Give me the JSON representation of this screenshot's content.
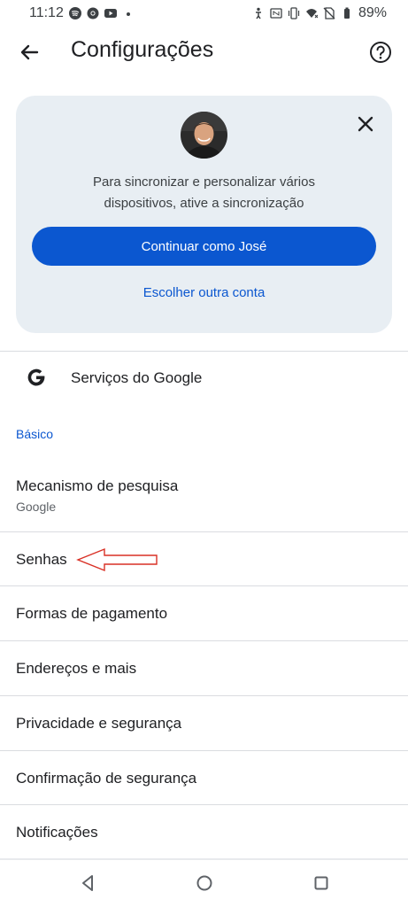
{
  "status": {
    "time": "11:12",
    "battery": "89%"
  },
  "appbar": {
    "title": "Configurações"
  },
  "sync_card": {
    "promo_line1": "Para sincronizar e personalizar vários",
    "promo_line2": "dispositivos, ative a sincronização",
    "continue_label": "Continuar como José",
    "other_account_label": "Escolher outra conta"
  },
  "google_services": {
    "label": "Serviços do Google"
  },
  "section": {
    "basic": "Básico"
  },
  "settings": {
    "search_engine": {
      "label": "Mecanismo de pesquisa",
      "value": "Google"
    },
    "passwords": "Senhas",
    "payment_methods": "Formas de pagamento",
    "addresses": "Endereços e mais",
    "privacy": "Privacidade e segurança",
    "safety_check": "Confirmação de segurança",
    "notifications": "Notificações"
  },
  "colors": {
    "accent": "#0b57d0",
    "card_bg": "#e8eef3",
    "annotation": "#d93025"
  },
  "icons": [
    "back-arrow",
    "help",
    "close",
    "google-g",
    "nav-back",
    "nav-home",
    "nav-recents"
  ]
}
